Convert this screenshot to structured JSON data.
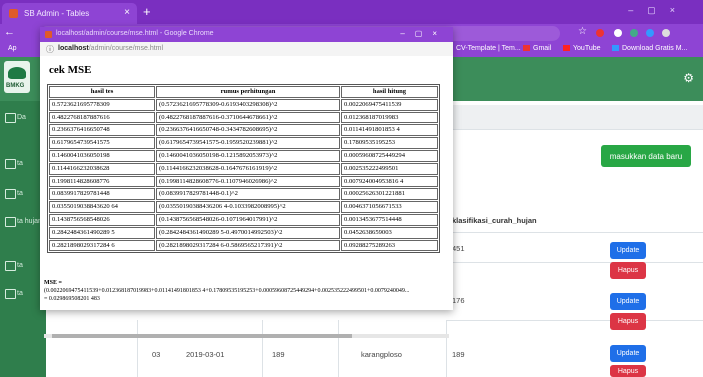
{
  "browser": {
    "tab_title": "SB Admin - Tables",
    "bookmarks": [
      "Ap",
      "CV-Template | Tem...",
      "Gmail",
      "YouTube",
      "Download Gratis M..."
    ]
  },
  "popup": {
    "window_title": "localhost/admin/course/mse.html - Google Chrome",
    "url_host": "localhost",
    "url_path": "/admin/course/mse.html",
    "heading": "cek MSE",
    "columns": [
      "hasil tes",
      "rumus perhitungan",
      "hasil hitung"
    ],
    "rows": [
      [
        "0.5723621695778309",
        "(0.5723621695778309-0.6193403298308)^2",
        "0.0022069475411539"
      ],
      [
        "0.4822768187887616",
        "(0.4822768187887616-0.3710644678661)^2",
        "0.012368187019983"
      ],
      [
        "0.2366376416650748",
        "(0.2366376416650748-0.3434782608695)^2",
        "0.01141491801853 4"
      ],
      [
        "0.6179654739541575",
        "(0.6179654739541575-0.1959520239881)^2",
        "0.17809535195253"
      ],
      [
        "0.1460041036050198",
        "(0.1460041036050198-0.1215892053973)^2",
        "0.00059608725449294"
      ],
      [
        "0.1144166232038628",
        "(0.1144166232038628-0.1647676161919)^2",
        "0.002535222499501"
      ],
      [
        "0.1998114828608776",
        "(0.1998114828608776-0.1107946026986)^2",
        "0.007924004953816 4"
      ],
      [
        "0.0839917829781448",
        "(0.0839917829781448-0.1)^2",
        "0.00025626301221881"
      ],
      [
        "0.0355019038843620 64",
        "(0.03550190388436206 4-0.1033982008995)^2",
        "0.0046371056671533"
      ],
      [
        "0.1438756568548026",
        "(0.1438756568548026-0.1071964017991)^2",
        "0.0013453677514448"
      ],
      [
        "0.2842484361490289 5",
        "(0.2842484361490289 5-0.4970014992503)^2",
        "0.0452638659003"
      ],
      [
        "0.2821898029317284 6",
        "(0.2821898029317284 6-0.5869565217391)^2",
        "0.09288275289263"
      ]
    ],
    "mse_label": "MSE =",
    "mse_formula": "(0.0022069475411539+0.012368187019983+0.01141491801853 4+0.17809535195253+0.00059608725449294+0.002535222499501+0.0079240049...",
    "mse_result": "= 0.029869508201 483"
  },
  "admin": {
    "add_button": "masukkan data baru",
    "column_header": "klasifikasi_curah_hujan",
    "row_values": [
      "451",
      "176",
      "189"
    ],
    "update_label": "Update",
    "delete_label": "Hapus",
    "sidebar_items": [
      "Da",
      "ta",
      "ta",
      "ta hujan",
      "ta",
      "ta"
    ],
    "last_row": {
      "no": "03",
      "date": "2019-03-01",
      "value": "189",
      "location": "karangploso"
    }
  },
  "colors": {
    "browser": "#8e44d4",
    "admin_green": "#3c8d5a",
    "update": "#1f6fe8",
    "delete": "#dc3545",
    "add": "#28a745"
  }
}
